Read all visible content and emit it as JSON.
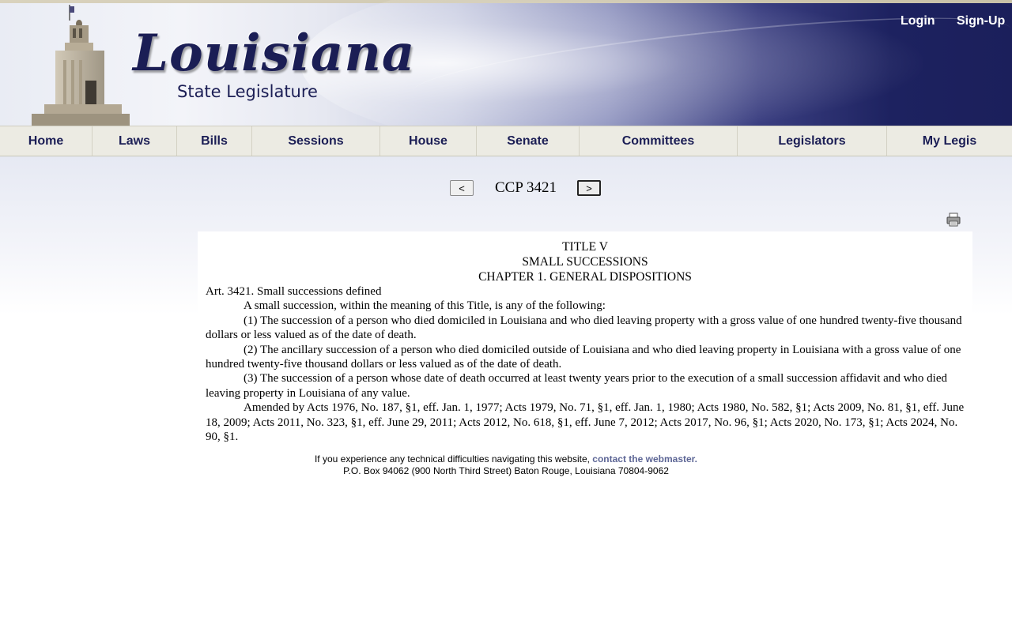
{
  "header": {
    "logo_script": "Louisiana",
    "logo_subtitle": "State Legislature",
    "login_label": "Login",
    "signup_label": "Sign-Up"
  },
  "nav": {
    "items": [
      {
        "label": "Home"
      },
      {
        "label": "Laws"
      },
      {
        "label": "Bills"
      },
      {
        "label": "Sessions"
      },
      {
        "label": "House"
      },
      {
        "label": "Senate"
      },
      {
        "label": "Committees"
      },
      {
        "label": "Legislators"
      },
      {
        "label": "My Legis"
      }
    ]
  },
  "pager": {
    "prev_label": "<",
    "next_label": ">",
    "title": "CCP 3421"
  },
  "document": {
    "title_line1": "TITLE V",
    "title_line2": "SMALL SUCCESSIONS",
    "title_line3": "CHAPTER 1. GENERAL DISPOSITIONS",
    "article_heading": "Art. 3421. Small successions defined",
    "intro": "A small succession, within the meaning of this Title, is any of the following:",
    "para1": "(1) The succession of a person who died domiciled in Louisiana and who died leaving property with a gross value of one hundred twenty-five thousand dollars or less valued as of the date of death.",
    "para2": "(2) The ancillary succession of a person who died domiciled outside of Louisiana and who died leaving property in Louisiana with a gross value of one hundred twenty-five thousand dollars or less valued as of the date of death.",
    "para3": "(3) The succession of a person whose date of death occurred at least twenty years prior to the execution of a small succession affidavit and who died leaving property in Louisiana of any value.",
    "amended": "Amended by Acts 1976, No. 187, §1, eff. Jan. 1, 1977; Acts 1979, No. 71, §1, eff. Jan. 1, 1980; Acts 1980, No. 582, §1; Acts 2009, No. 81, §1, eff. June 18, 2009; Acts 2011, No. 323, §1, eff. June 29, 2011; Acts 2012, No. 618, §1, eff. June 7, 2012; Acts 2017, No. 96, §1; Acts 2020, No. 173, §1; Acts 2024, No. 90, §1."
  },
  "footer": {
    "text": "If you experience any technical difficulties navigating this website,",
    "link": "contact the webmaster.",
    "address": "P.O. Box 94062 (900 North Third Street) Baton Rouge, Louisiana 70804-9062"
  },
  "colors": {
    "brand_navy": "#1b1e55",
    "nav_bg": "#ecebe3",
    "link": "#5c6595"
  }
}
